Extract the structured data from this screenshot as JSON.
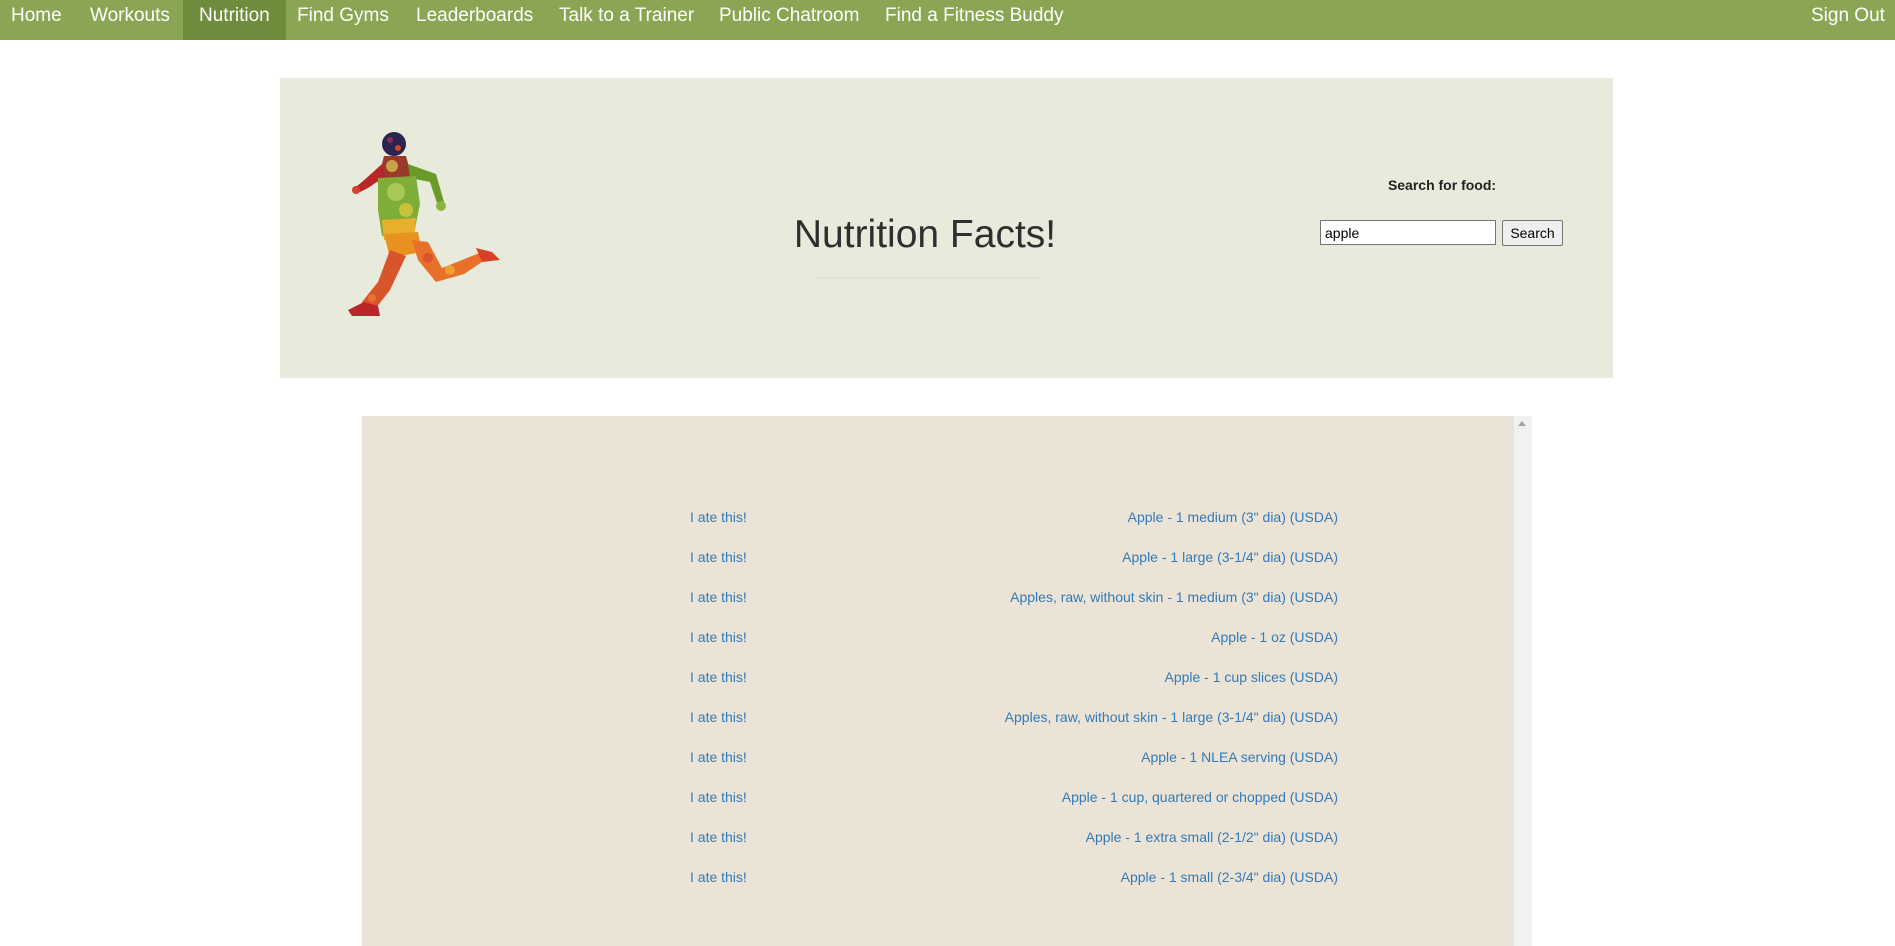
{
  "nav": {
    "items": [
      {
        "label": "Home"
      },
      {
        "label": "Workouts"
      },
      {
        "label": "Nutrition"
      },
      {
        "label": "Find Gyms"
      },
      {
        "label": "Leaderboards"
      },
      {
        "label": "Talk to a Trainer"
      },
      {
        "label": "Public Chatroom"
      },
      {
        "label": "Find a Fitness Buddy"
      }
    ],
    "active": "Nutrition",
    "sign_out": "Sign Out"
  },
  "header": {
    "title": "Nutrition Facts!",
    "logo_icon": "fruit-runner-icon"
  },
  "search": {
    "label": "Search for food:",
    "value": "apple",
    "button_label": "Search"
  },
  "results": {
    "action_label": "I ate this!",
    "items": [
      {
        "food": "Apple - 1 medium (3\" dia) (USDA)"
      },
      {
        "food": "Apple - 1 large (3-1/4\" dia) (USDA)"
      },
      {
        "food": "Apples, raw, without skin - 1 medium (3\" dia) (USDA)"
      },
      {
        "food": "Apple - 1 oz (USDA)"
      },
      {
        "food": "Apple - 1 cup slices (USDA)"
      },
      {
        "food": "Apples, raw, without skin - 1 large (3-1/4\" dia) (USDA)"
      },
      {
        "food": "Apple - 1 NLEA serving (USDA)"
      },
      {
        "food": "Apple - 1 cup, quartered or chopped (USDA)"
      },
      {
        "food": "Apple - 1 extra small (2-1/2\" dia) (USDA)"
      },
      {
        "food": "Apple - 1 small (2-3/4\" dia) (USDA)"
      }
    ]
  },
  "colors": {
    "nav_bg": "#8aa654",
    "nav_active_bg": "#6f8c3c",
    "header_bg": "#e8ebdb",
    "results_bg": "#ebe4d6",
    "link": "#337ab7"
  }
}
